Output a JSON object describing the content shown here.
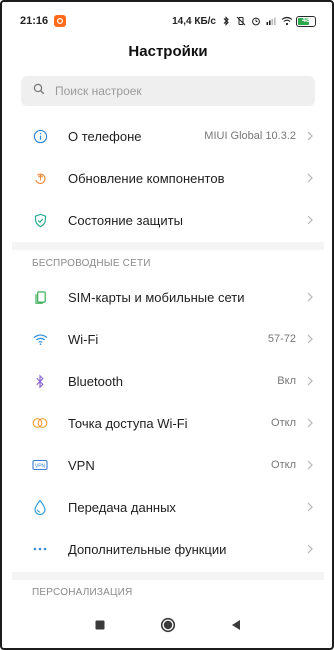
{
  "status_bar": {
    "time": "21:16",
    "net_speed": "14,4 КБ/с",
    "battery_level": "48"
  },
  "header": {
    "title": "Настройки"
  },
  "search": {
    "placeholder": "Поиск настроек"
  },
  "sections": {
    "device": {
      "items": [
        {
          "label": "О телефоне",
          "value": "MIUI Global 10.3.2",
          "icon": "info-icon"
        },
        {
          "label": "Обновление компонентов",
          "value": "",
          "icon": "update-icon"
        },
        {
          "label": "Состояние защиты",
          "value": "",
          "icon": "shield-icon"
        }
      ]
    },
    "wireless": {
      "header": "БЕСПРОВОДНЫЕ СЕТИ",
      "items": [
        {
          "label": "SIM-карты и мобильные сети",
          "value": "",
          "icon": "sim-icon"
        },
        {
          "label": "Wi-Fi",
          "value": "57-72",
          "icon": "wifi-icon"
        },
        {
          "label": "Bluetooth",
          "value": "Вкл",
          "icon": "bluetooth-icon"
        },
        {
          "label": "Точка доступа Wi-Fi",
          "value": "Откл",
          "icon": "hotspot-icon"
        },
        {
          "label": "VPN",
          "value": "Откл",
          "icon": "vpn-icon"
        },
        {
          "label": "Передача данных",
          "value": "",
          "icon": "data-usage-icon"
        },
        {
          "label": "Дополнительные функции",
          "value": "",
          "icon": "more-icon"
        }
      ]
    },
    "personalization": {
      "header": "ПЕРСОНАЛИЗАЦИЯ"
    }
  },
  "nav": {
    "icons": [
      "recents-icon",
      "home-icon",
      "back-icon"
    ]
  },
  "colors": {
    "info": "#2e86d6",
    "update": "#f08a3c",
    "shield": "#23a68a",
    "sim": "#2aa84a",
    "wifi": "#2f8fe0",
    "bluetooth": "#8a63d2",
    "hotspot": "#f0a13c",
    "vpn": "#3a7fd8",
    "data": "#3a9fd8",
    "more": "#3a8fd8"
  }
}
